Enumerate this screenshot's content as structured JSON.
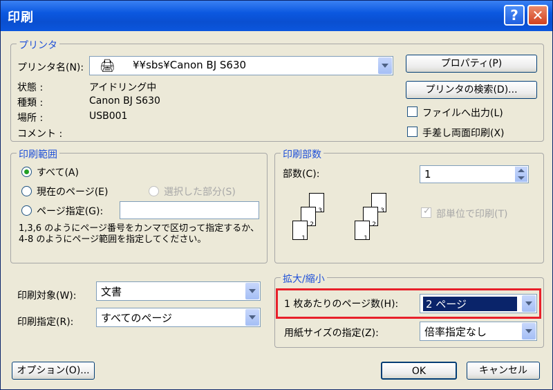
{
  "window": {
    "title": "印刷",
    "help_label": "?",
    "close_label": "✕"
  },
  "printer": {
    "group_label": "プリンタ",
    "name_label": "プリンタ名(N):",
    "name_value": "¥¥sbs¥Canon BJ S630",
    "properties_button": "プロパティ(P)",
    "find_button": "プリンタの検索(D)...",
    "status_label": "状態 :",
    "status_value": "アイドリング中",
    "type_label": "種類 :",
    "type_value": "Canon BJ S630",
    "where_label": "場所 :",
    "where_value": "USB001",
    "comment_label": "コメント :",
    "print_to_file": "ファイルへ出力(L)",
    "manual_duplex": "手差し両面印刷(X)"
  },
  "range": {
    "group_label": "印刷範囲",
    "all": "すべて(A)",
    "current": "現在のページ(E)",
    "selection": "選択した部分(S)",
    "pages": "ページ指定(G):",
    "hint": "1,3,6 のようにページ番号をカンマで区切って指定するか、4-8 のようにページ範囲を指定してください。"
  },
  "copies": {
    "group_label": "印刷部数",
    "count_label": "部数(C):",
    "count_value": "1",
    "collate": "部単位で印刷(T)",
    "page_numbers": [
      "1",
      "2",
      "3"
    ]
  },
  "print_what": {
    "label": "印刷対象(W):",
    "value": "文書"
  },
  "print_spec": {
    "label": "印刷指定(R):",
    "value": "すべてのページ"
  },
  "zoom": {
    "group_label": "拡大/縮小",
    "pages_per_sheet_label": "1 枚あたりのページ数(H):",
    "pages_per_sheet_value": "2 ページ",
    "scale_label": "用紙サイズの指定(Z):",
    "scale_value": "倍率指定なし"
  },
  "footer": {
    "options": "オプション(O)...",
    "ok": "OK",
    "cancel": "キャンセル"
  },
  "colors": {
    "accent": "#1d4fd8",
    "highlight": "#e8202a",
    "title_bar": "#0b58e0"
  }
}
